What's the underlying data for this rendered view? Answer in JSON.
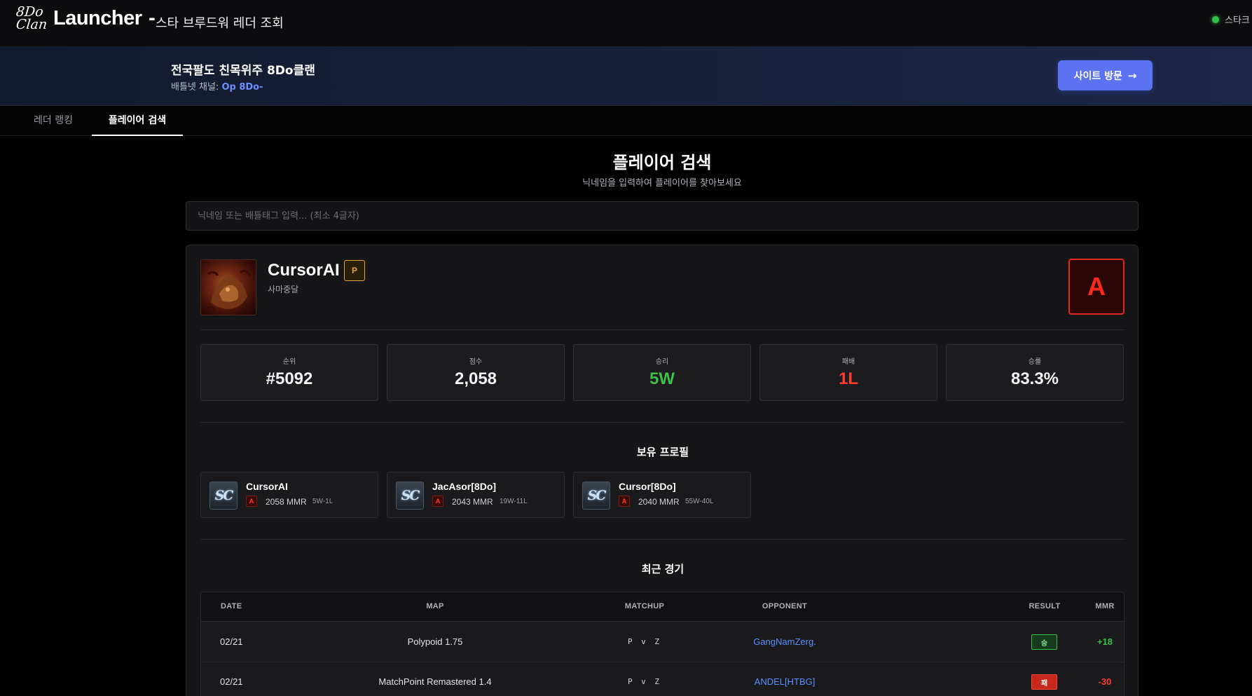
{
  "header": {
    "logo_line1": "8Do",
    "logo_line2": "Clan",
    "title": "Launcher",
    "title_dash": "-",
    "subtitle": "스타 브루드워 레더 조회",
    "status_text": "스타크"
  },
  "banner": {
    "title": "전국팔도 친목위주 8Do클랜",
    "channel_label": "배틀넷 채널: ",
    "channel_name": "Op 8Do-",
    "visit_button": "사이트 방문",
    "visit_arrow": "→"
  },
  "tabs": [
    {
      "label": "레더 랭킹"
    },
    {
      "label": "플레이어 검색"
    }
  ],
  "search_page": {
    "title": "플레이어 검색",
    "subtitle": "닉네임을 입력하여 플레이어를 찾아보세요",
    "placeholder": "닉네임 또는 배틀태그 입력... (최소 4글자)",
    "value": ""
  },
  "player": {
    "name": "CursorAI",
    "race_badge": "P",
    "subtitle": "사마중달",
    "grade": "A",
    "stats": [
      {
        "label": "순위",
        "value": "#5092"
      },
      {
        "label": "점수",
        "value": "2,058"
      },
      {
        "label": "승리",
        "value": "5W"
      },
      {
        "label": "패배",
        "value": "1L"
      },
      {
        "label": "승률",
        "value": "83.3%"
      }
    ]
  },
  "profiles_section": {
    "title": "보유 프로필",
    "items": [
      {
        "icon": "SC",
        "name": "CursorAI",
        "grade": "A",
        "mmr": "2058 MMR",
        "record": "5W-1L"
      },
      {
        "icon": "SC",
        "name": "JacAsor[8Do]",
        "grade": "A",
        "mmr": "2043 MMR",
        "record": "19W-11L"
      },
      {
        "icon": "SC",
        "name": "Cursor[8Do]",
        "grade": "A",
        "mmr": "2040 MMR",
        "record": "55W-40L"
      }
    ]
  },
  "matches_section": {
    "title": "최근 경기",
    "columns": [
      "DATE",
      "MAP",
      "MATCHUP",
      "OPPONENT",
      "RESULT",
      "MMR"
    ],
    "rows": [
      {
        "date": "02/21",
        "map": "Polypoid 1.75",
        "matchup": "P v Z",
        "opponent": "GangNamZerg.",
        "result": "승",
        "mmr": "+18"
      },
      {
        "date": "02/21",
        "map": "MatchPoint Remastered 1.4",
        "matchup": "P v Z",
        "opponent": "ANDEL[HTBG]",
        "result": "패",
        "mmr": "-30"
      }
    ]
  },
  "colors": {
    "accent": "#5b73f0",
    "win": "#3fbf4a",
    "loss": "#ff3b2e",
    "protoss": "#e2a23a",
    "link": "#5d8fff"
  }
}
